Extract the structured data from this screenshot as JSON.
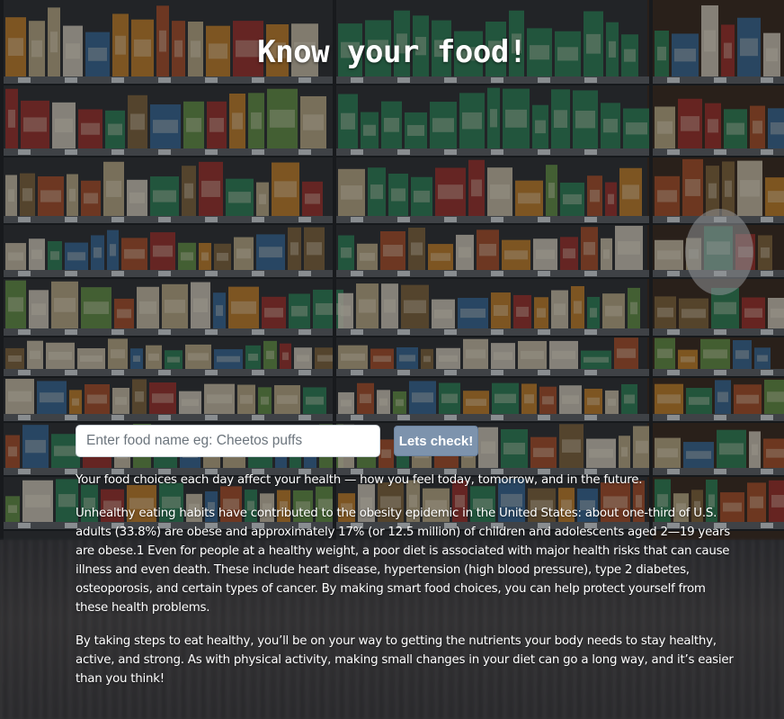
{
  "page": {
    "title": "Know your food!"
  },
  "search": {
    "placeholder": "Enter food name eg: Cheetos puffs",
    "value": "",
    "button_label": "Lets check!"
  },
  "article": {
    "paragraphs": [
      "Your food choices each day affect your health — how you feel today, tomorrow, and in the future.",
      "Unhealthy eating habits have contributed to the obesity epidemic in the United States: about one-third of U.S. adults (33.8%) are obese and approximately 17% (or 12.5 million) of children and adolescents aged 2—19 years are obese.1 Even for people at a healthy weight, a poor diet is associated with major health risks that can cause illness and even death. These include heart disease, hypertension (high blood pressure), type 2 diabetes, osteoporosis, and certain types of cancer. By making smart food choices, you can help protect yourself from these health problems.",
      "By taking steps to eat healthy, you’ll be on your way to getting the nutrients your body needs to stay healthy, active, and strong. As with physical activity, making small changes in your diet can go a long way, and it’s easier than you think!"
    ]
  },
  "background": {
    "description_icon": "grocery-shelves-image",
    "colors": {
      "shelf": "#5b5e63",
      "box_green": "#2f8a5c",
      "box_orange": "#d28a2c",
      "box_red": "#a8322d",
      "box_cream": "#d9cdb4",
      "box_blue": "#3a6fa0"
    }
  },
  "colors": {
    "button_bg": "#7d93ad",
    "input_bg": "#ffffff",
    "text": "#ffffff"
  }
}
